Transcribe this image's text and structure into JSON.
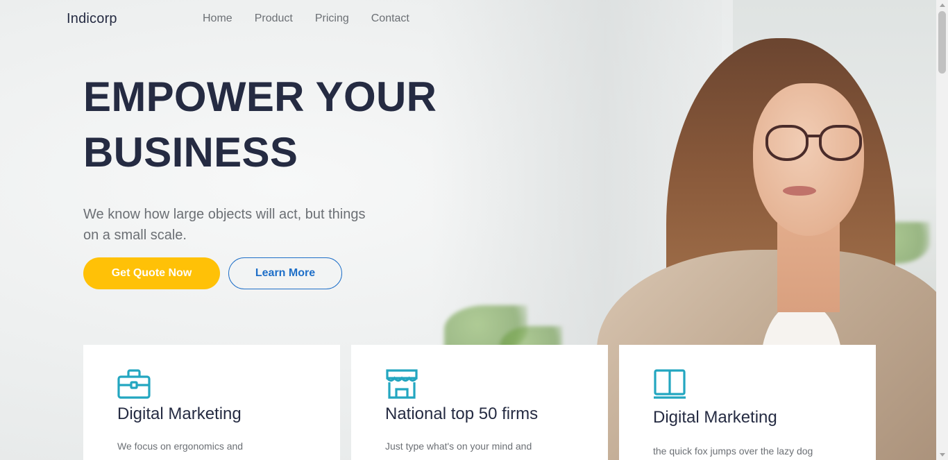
{
  "nav": {
    "brand": "Indicorp",
    "links": [
      "Home",
      "Product",
      "Pricing",
      "Contact"
    ]
  },
  "hero": {
    "title_line1": "EMPOWER YOUR",
    "title_line2": "BUSINESS",
    "subtitle": "We know how large objects will act, but things on a small scale.",
    "primary_button": "Get Quote Now",
    "secondary_button": "Learn More"
  },
  "cards": [
    {
      "icon": "briefcase-icon",
      "title": "Digital Marketing",
      "text": "We focus on ergonomics and"
    },
    {
      "icon": "storefront-icon",
      "title": "National top 50 firms",
      "text": "Just type what's on your mind and"
    },
    {
      "icon": "book-icon",
      "title": "Digital Marketing",
      "text": "the quick fox jumps over the lazy dog"
    }
  ],
  "colors": {
    "heading": "#252b42",
    "muted_text": "#6b6f74",
    "primary_button": "#ffc107",
    "secondary_button": "#1e6fc8",
    "icon_accent": "#23a6c0"
  }
}
